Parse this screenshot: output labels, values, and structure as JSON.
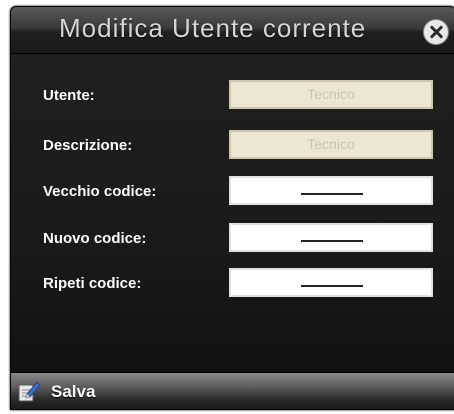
{
  "window": {
    "title": "Modifica Utente corrente",
    "close_icon": "close-icon"
  },
  "form": {
    "fields": [
      {
        "label": "Utente:",
        "value": "Tecnico",
        "readonly": true
      },
      {
        "label": "Descrizione:",
        "value": "Tecnico",
        "readonly": true
      },
      {
        "label": "Vecchio codice:",
        "value": "",
        "readonly": false,
        "masked": true
      },
      {
        "label": "Nuovo codice:",
        "value": "",
        "readonly": false,
        "masked": true
      },
      {
        "label": "Ripeti codice:",
        "value": "",
        "readonly": false,
        "masked": true
      }
    ]
  },
  "footer": {
    "save_label": "Salva",
    "save_icon": "edit-pencil-icon"
  },
  "colors": {
    "window_bg": "#1c1c1c",
    "readonly_field_bg": "#ece6d2",
    "editable_field_bg": "#ffffff"
  }
}
